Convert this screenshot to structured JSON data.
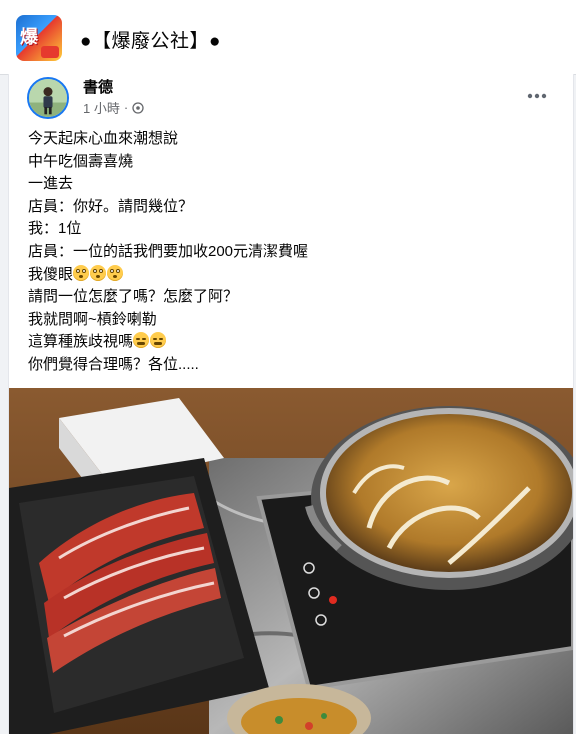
{
  "group": {
    "title": "●【爆廢公社】●",
    "logo_icon": "group-logo-icon"
  },
  "post": {
    "author": "書德",
    "time": "1 小時",
    "separator": "·",
    "privacy_icon": "globe-icon",
    "more_icon": "more-options-icon",
    "lines": [
      "今天起床心血來潮想說",
      "中午吃個壽喜燒",
      "一進去",
      "店員：你好。請問幾位？",
      "我：1位",
      "店員：一位的話我們要加收200元清潔費喔",
      "我傻眼",
      "請問一位怎麼了嗎？怎麼了阿？",
      "我就問啊~槓鈴喇勒",
      "這算種族歧視嗎",
      "你們覺得合理嗎？各位....."
    ],
    "emoji_after_line_7": [
      "flushed-face-emoji",
      "flushed-face-emoji",
      "flushed-face-emoji"
    ],
    "emoji_after_line_10": [
      "tired-face-emoji",
      "tired-face-emoji"
    ],
    "photo": "hot-pot-sukiyaki-photo"
  },
  "colors": {
    "page_bg": "#f0f2f5",
    "card_bg": "#ffffff",
    "accent": "#1877f2",
    "secondary_text": "#65676b"
  }
}
